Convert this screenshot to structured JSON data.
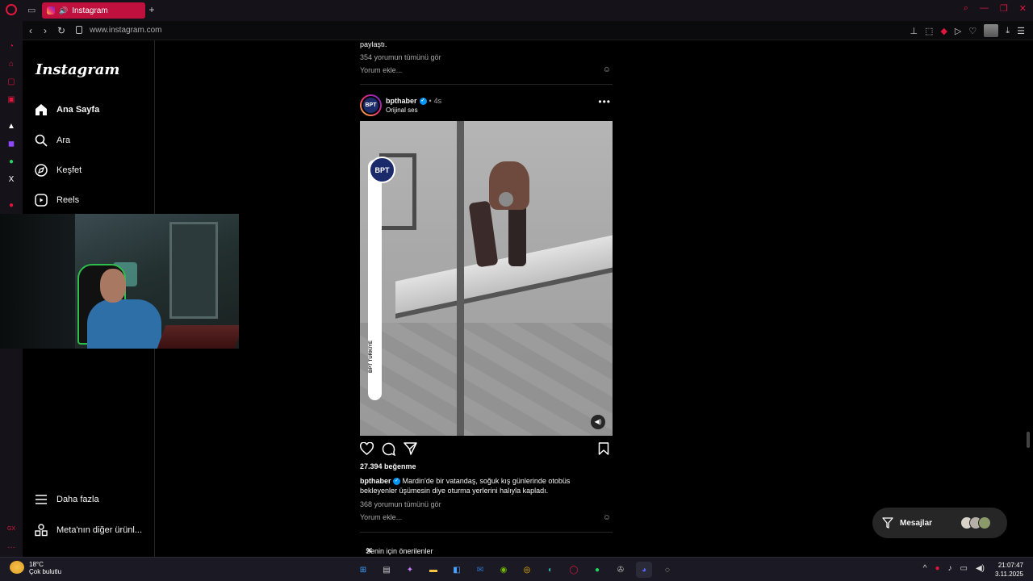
{
  "browser": {
    "tab_title": "Instagram",
    "url": "www.instagram.com"
  },
  "sidebar": {
    "logo": "Instagram",
    "items": [
      {
        "label": "Ana Sayfa",
        "icon": "home-icon"
      },
      {
        "label": "Ara",
        "icon": "search-icon"
      },
      {
        "label": "Keşfet",
        "icon": "compass-icon"
      },
      {
        "label": "Reels",
        "icon": "reels-icon"
      }
    ],
    "bottom": [
      {
        "label": "Daha fazla",
        "icon": "menu-icon"
      },
      {
        "label": "Meta'nın diğer ürünl...",
        "icon": "apps-icon"
      }
    ]
  },
  "prev_post": {
    "text": "paylaştı.",
    "comments": "354 yorumun tümünü gör",
    "add_comment": "Yorum ekle..."
  },
  "post": {
    "username": "bpthaber",
    "time": "4s",
    "audio": "Orijinal ses",
    "avatar_text": "BPT",
    "overlay_text": "BPT TÜRKİYE",
    "likes": "27.394 beğenme",
    "caption_user": "bpthaber",
    "caption": "Mardin'de bir vatandaş, soğuk kış günlerinde otobüs bekleyenler üşümesin diye oturma yerlerini halıyla kapladı.",
    "comments": "368 yorumun tümünü gör",
    "add_comment": "Yorum ekle..."
  },
  "suggestions": {
    "title": "Senin için önerilenler"
  },
  "messages": {
    "label": "Mesajlar"
  },
  "taskbar": {
    "temperature": "18°C",
    "weather": "Çok bulutlu",
    "time": "21:07:47",
    "date": "3.11.2025"
  },
  "colors": {
    "opera_red": "#e0163c",
    "tab_bg": "#c0103d",
    "verified_blue": "#0095f6",
    "secondary_text": "#a8a8a8"
  }
}
